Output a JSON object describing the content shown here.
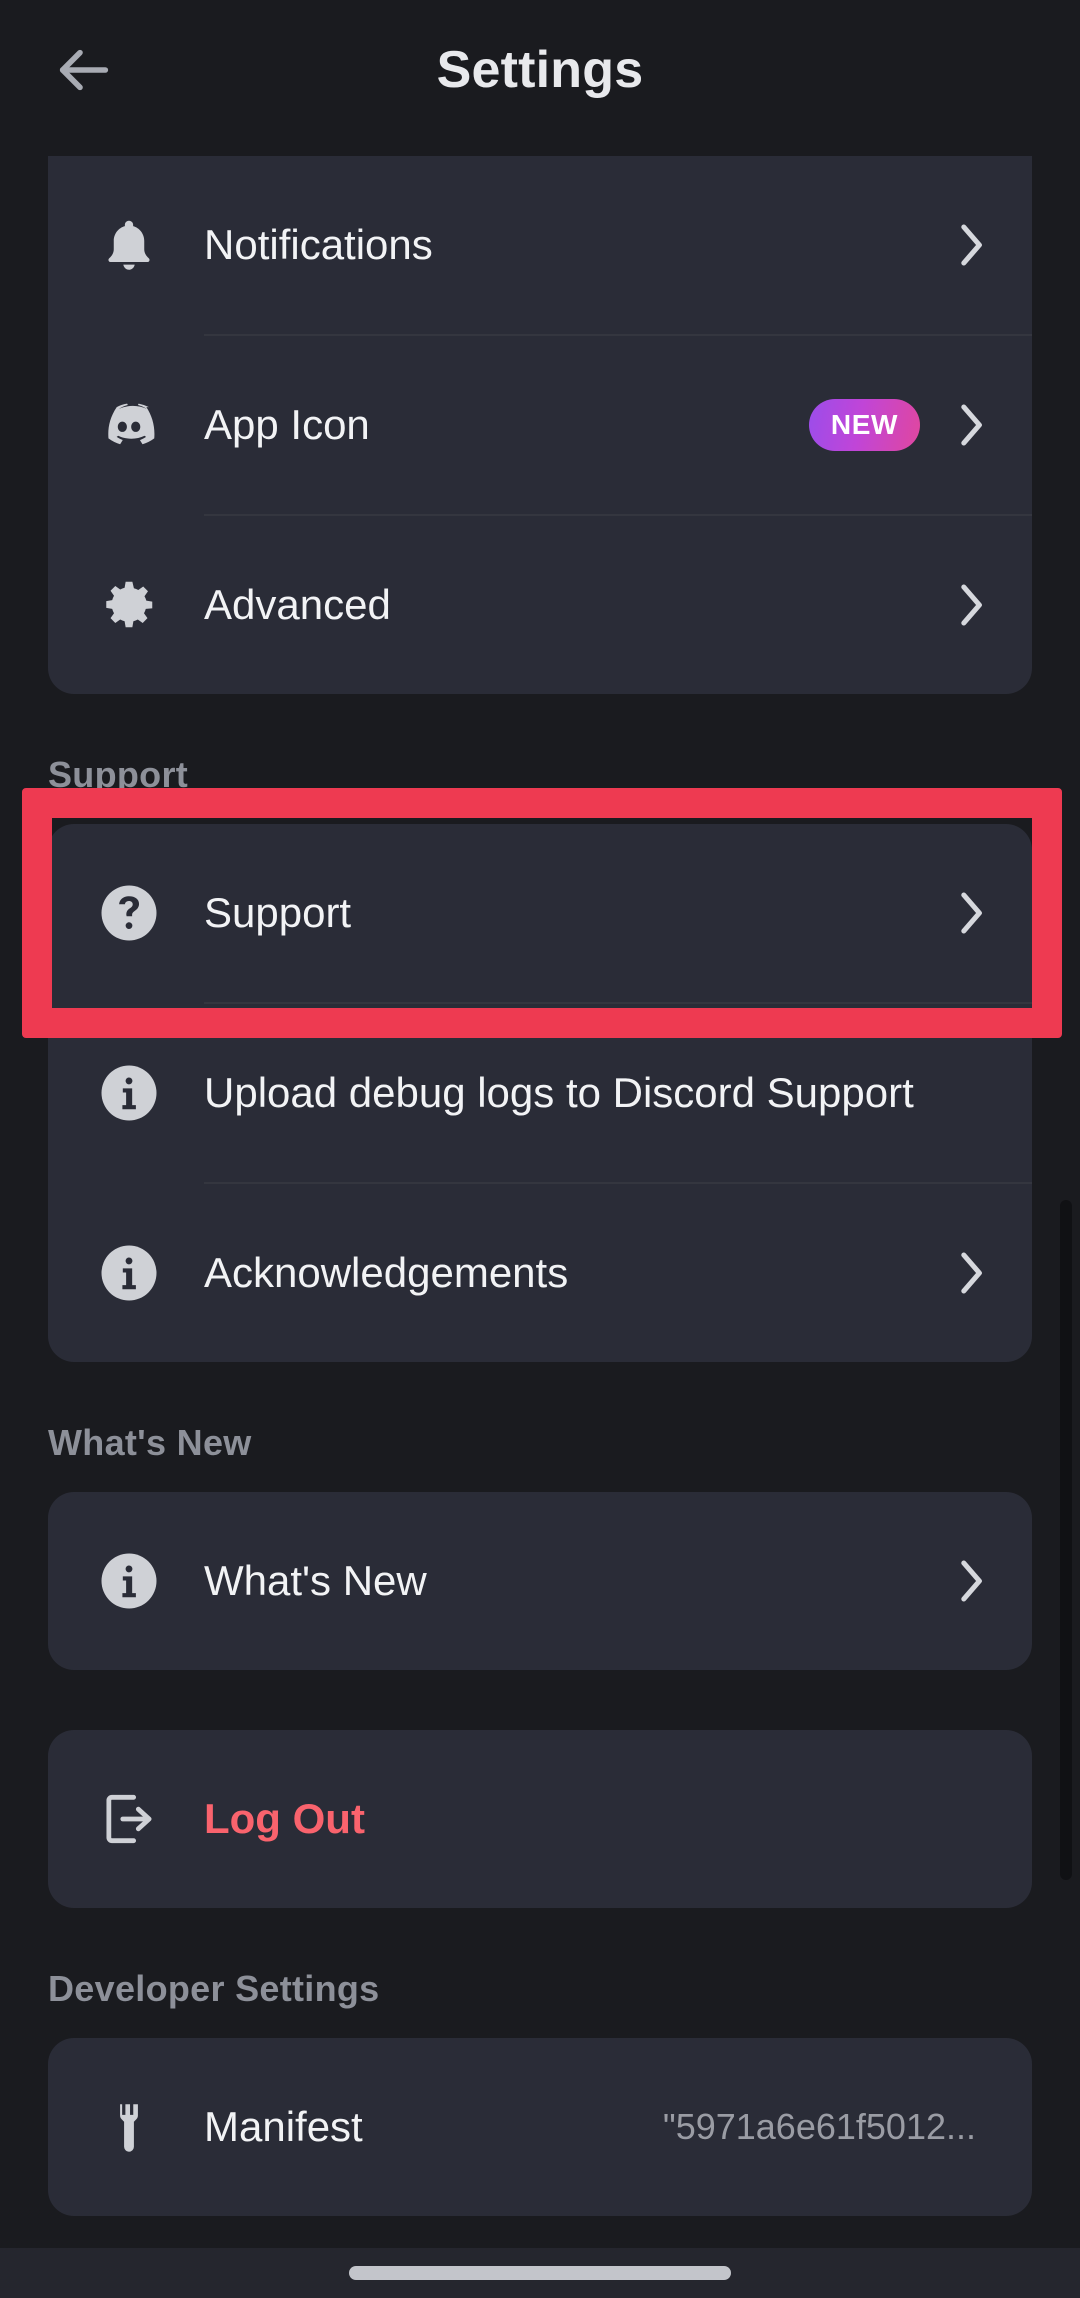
{
  "header": {
    "title": "Settings",
    "back_icon": "arrow-left-icon"
  },
  "colors": {
    "page_background": "#1a1b1f",
    "card_background": "#2a2c37",
    "accent_highlight": "#ee3a51",
    "danger_text": "#f9636d",
    "section_label": "#8d9099",
    "badge_gradient_start": "#9b4dea",
    "badge_gradient_end": "#e0479f"
  },
  "groups": [
    {
      "name": "app-settings-group",
      "section_label": null,
      "clipped_top": true,
      "rows": [
        {
          "label": "Notifications",
          "icon": "bell-icon",
          "chevron": true,
          "badge": null,
          "value": null
        },
        {
          "label": "App Icon",
          "icon": "discord-logo-icon",
          "chevron": true,
          "badge": "NEW",
          "value": null
        },
        {
          "label": "Advanced",
          "icon": "gear-icon",
          "chevron": true,
          "badge": null,
          "value": null
        }
      ]
    },
    {
      "name": "support-group",
      "section_label": "Support",
      "clipped_top": false,
      "rows": [
        {
          "label": "Support",
          "icon": "question-circle-icon",
          "chevron": true,
          "badge": null,
          "value": null,
          "highlighted": true
        },
        {
          "label": "Upload debug logs to Discord Support",
          "icon": "info-circle-icon",
          "chevron": false,
          "badge": null,
          "value": null
        },
        {
          "label": "Acknowledgements",
          "icon": "info-circle-icon",
          "chevron": true,
          "badge": null,
          "value": null
        }
      ]
    },
    {
      "name": "whats-new-group",
      "section_label": "What's New",
      "clipped_top": false,
      "rows": [
        {
          "label": "What's New",
          "icon": "info-circle-icon",
          "chevron": true,
          "badge": null,
          "value": null
        }
      ]
    },
    {
      "name": "logout-group",
      "section_label": null,
      "clipped_top": false,
      "rows": [
        {
          "label": "Log Out",
          "icon": "sign-out-icon",
          "chevron": false,
          "badge": null,
          "value": null,
          "danger": true
        }
      ]
    },
    {
      "name": "developer-settings-group",
      "section_label": "Developer Settings",
      "clipped_top": false,
      "rows": [
        {
          "label": "Manifest",
          "icon": "wrench-icon",
          "chevron": false,
          "badge": null,
          "value": "\"5971a6e61f5012..."
        }
      ]
    }
  ],
  "system": {
    "home_indicator": "home-indicator-bar",
    "scrollbar": "vertical-scrollbar"
  }
}
